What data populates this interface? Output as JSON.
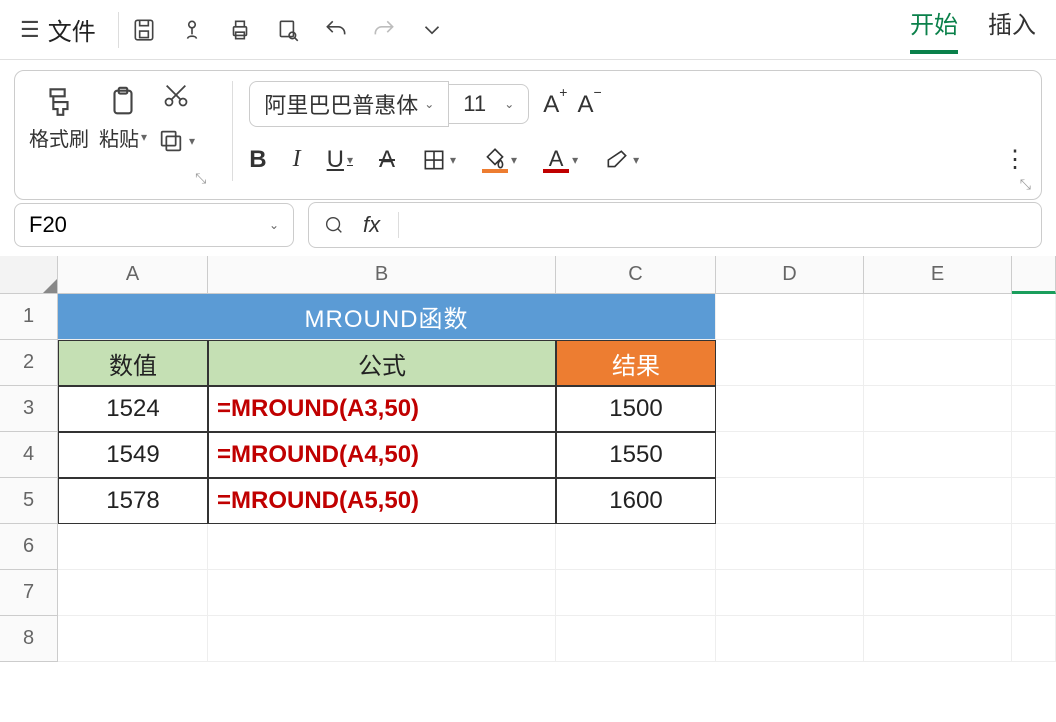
{
  "topbar": {
    "file_label": "文件",
    "tabs": {
      "start": "开始",
      "insert": "插入"
    }
  },
  "ribbon": {
    "format_painter": "格式刷",
    "paste": "粘贴",
    "font_name": "阿里巴巴普惠体",
    "font_size": "11",
    "buttons": {
      "bold": "B",
      "italic": "I",
      "underline": "U",
      "strike": "A"
    }
  },
  "namebox": {
    "ref": "F20"
  },
  "formulabar": {
    "fx": "fx",
    "value": ""
  },
  "columns": [
    "A",
    "B",
    "C",
    "D",
    "E"
  ],
  "rows": [
    "1",
    "2",
    "3",
    "4",
    "5",
    "6",
    "7",
    "8"
  ],
  "table": {
    "title": "MROUND函数",
    "headers": {
      "value": "数值",
      "formula": "公式",
      "result": "结果"
    },
    "data": [
      {
        "value": "1524",
        "formula": "=MROUND(A3,50)",
        "result": "1500"
      },
      {
        "value": "1549",
        "formula": "=MROUND(A4,50)",
        "result": "1550"
      },
      {
        "value": "1578",
        "formula": "=MROUND(A5,50)",
        "result": "1600"
      }
    ]
  }
}
